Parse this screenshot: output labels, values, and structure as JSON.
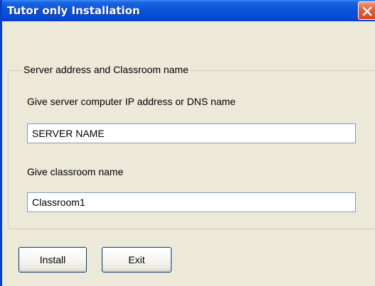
{
  "window": {
    "title": "Tutor only Installation",
    "close_icon": "close-icon"
  },
  "group": {
    "legend": "Server address and Classroom name",
    "server_label": "Give server computer IP address or DNS name",
    "server_value": "SERVER NAME",
    "classroom_label": "Give classroom name",
    "classroom_value": "Classroom1"
  },
  "buttons": {
    "install_label": "Install",
    "exit_label": "Exit"
  },
  "colors": {
    "titlebar": "#0a53d9",
    "close_button": "#d8461e",
    "dialog_background": "#ece9d8"
  }
}
